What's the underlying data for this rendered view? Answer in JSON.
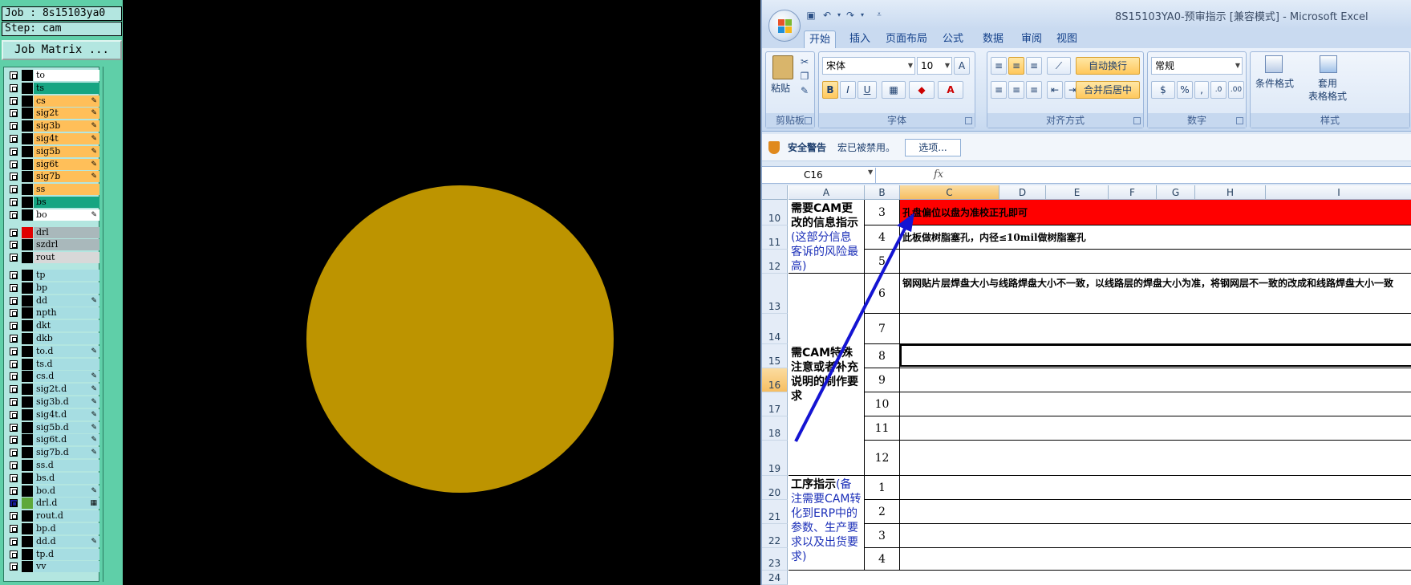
{
  "cam": {
    "job_line": "Job : 8s15103ya0",
    "step_line": "Step: cam",
    "job_matrix_label": "Job Matrix ...",
    "layers": [
      {
        "name": "to",
        "bg": "#ffffff",
        "swatch": "#000000",
        "mark": ""
      },
      {
        "name": "ts",
        "bg": "#16a582",
        "swatch": "#000000",
        "mark": ""
      },
      {
        "name": "cs",
        "bg": "#ffbf59",
        "swatch": "#000000",
        "mark": "✎"
      },
      {
        "name": "sig2t",
        "bg": "#ffbf59",
        "swatch": "#000000",
        "mark": "✎"
      },
      {
        "name": "sig3b",
        "bg": "#ffbf59",
        "swatch": "#000000",
        "mark": "✎"
      },
      {
        "name": "sig4t",
        "bg": "#ffbf59",
        "swatch": "#000000",
        "mark": "✎"
      },
      {
        "name": "sig5b",
        "bg": "#ffbf59",
        "swatch": "#000000",
        "mark": "✎"
      },
      {
        "name": "sig6t",
        "bg": "#ffbf59",
        "swatch": "#000000",
        "mark": "✎"
      },
      {
        "name": "sig7b",
        "bg": "#ffbf59",
        "swatch": "#000000",
        "mark": "✎"
      },
      {
        "name": "ss",
        "bg": "#ffbf59",
        "swatch": "#000000",
        "mark": ""
      },
      {
        "name": "bs",
        "bg": "#16a582",
        "swatch": "#000000",
        "mark": ""
      },
      {
        "name": "bo",
        "bg": "#ffffff",
        "swatch": "#000000",
        "mark": "✎"
      },
      {
        "name": "drl",
        "bg": "#a9b8bb",
        "swatch": "#e00000",
        "mark": ""
      },
      {
        "name": "szdrl",
        "bg": "#a9b8bb",
        "swatch": "#000000",
        "mark": ""
      },
      {
        "name": "rout",
        "bg": "#d8d8d8",
        "swatch": "#000000",
        "mark": ""
      },
      {
        "name": "tp",
        "bg": "#a6dde2",
        "swatch": "#000000",
        "mark": ""
      },
      {
        "name": "bp",
        "bg": "#a6dde2",
        "swatch": "#000000",
        "mark": ""
      },
      {
        "name": "dd",
        "bg": "#a6dde2",
        "swatch": "#000000",
        "mark": "✎"
      },
      {
        "name": "npth",
        "bg": "#a6dde2",
        "swatch": "#000000",
        "mark": ""
      },
      {
        "name": "dkt",
        "bg": "#a6dde2",
        "swatch": "#000000",
        "mark": ""
      },
      {
        "name": "dkb",
        "bg": "#a6dde2",
        "swatch": "#000000",
        "mark": ""
      },
      {
        "name": "to.d",
        "bg": "#a6dde2",
        "swatch": "#000000",
        "mark": "✎"
      },
      {
        "name": "ts.d",
        "bg": "#a6dde2",
        "swatch": "#000000",
        "mark": ""
      },
      {
        "name": "cs.d",
        "bg": "#a6dde2",
        "swatch": "#000000",
        "mark": "✎"
      },
      {
        "name": "sig2t.d",
        "bg": "#a6dde2",
        "swatch": "#000000",
        "mark": "✎"
      },
      {
        "name": "sig3b.d",
        "bg": "#a6dde2",
        "swatch": "#000000",
        "mark": "✎"
      },
      {
        "name": "sig4t.d",
        "bg": "#a6dde2",
        "swatch": "#000000",
        "mark": "✎"
      },
      {
        "name": "sig5b.d",
        "bg": "#a6dde2",
        "swatch": "#000000",
        "mark": "✎"
      },
      {
        "name": "sig6t.d",
        "bg": "#a6dde2",
        "swatch": "#000000",
        "mark": "✎"
      },
      {
        "name": "sig7b.d",
        "bg": "#a6dde2",
        "swatch": "#000000",
        "mark": "✎"
      },
      {
        "name": "ss.d",
        "bg": "#a6dde2",
        "swatch": "#000000",
        "mark": ""
      },
      {
        "name": "bs.d",
        "bg": "#a6dde2",
        "swatch": "#000000",
        "mark": ""
      },
      {
        "name": "bo.d",
        "bg": "#a6dde2",
        "swatch": "#000000",
        "mark": "✎"
      },
      {
        "name": "drl.d",
        "bg": "#a6dde2",
        "swatch": "#5ea83a",
        "mark": "▦"
      },
      {
        "name": "rout.d",
        "bg": "#a6dde2",
        "swatch": "#000000",
        "mark": ""
      },
      {
        "name": "bp.d",
        "bg": "#a6dde2",
        "swatch": "#000000",
        "mark": ""
      },
      {
        "name": "dd.d",
        "bg": "#a6dde2",
        "swatch": "#000000",
        "mark": "✎"
      },
      {
        "name": "tp.d",
        "bg": "#a6dde2",
        "swatch": "#000000",
        "mark": ""
      },
      {
        "name": "vv",
        "bg": "#a6dde2",
        "swatch": "#000000",
        "mark": ""
      }
    ],
    "pad_color": "#bd9400"
  },
  "excel": {
    "title": "8S15103YA0-预审指示  [兼容模式]  -  Microsoft Excel",
    "tabs": [
      "开始",
      "插入",
      "页面布局",
      "公式",
      "数据",
      "审阅",
      "视图"
    ],
    "active_tab": "开始",
    "ribbon": {
      "clipboard": {
        "paste": "粘贴",
        "group": "剪贴板"
      },
      "font": {
        "name": "宋体",
        "size": "10",
        "group": "字体",
        "bold": "B",
        "italic": "I",
        "underline": "U",
        "grow": "A",
        "shrink": "A"
      },
      "alignment": {
        "wrap": "自动换行",
        "merge": "合并后居中",
        "group": "对齐方式"
      },
      "number": {
        "format": "常规",
        "percent": "%",
        "comma": ",",
        "group": "数字"
      },
      "styles": {
        "conditional": "条件格式",
        "table_line1": "套用",
        "table_line2": "表格格式",
        "group": "样式"
      }
    },
    "security": {
      "title": "安全警告",
      "message": "宏已被禁用。",
      "options": "选项..."
    },
    "name_box": "C16",
    "fx": "fx",
    "columns": [
      "A",
      "B",
      "C",
      "D",
      "E",
      "F",
      "G",
      "H",
      "I"
    ],
    "selected_column": "C",
    "rows": [
      "10",
      "11",
      "12",
      "13",
      "14",
      "15",
      "16",
      "17",
      "18",
      "19",
      "20",
      "21",
      "22",
      "23",
      "24"
    ],
    "selected_row": "16",
    "section_a1": {
      "bold": "需要CAM更改的信息指示",
      "note": "(这部分信息客诉的风险最高)"
    },
    "section_a2": {
      "bold": "需CAM特殊注意或者补充说明的制作要求"
    },
    "section_a3": {
      "bold": "工序指示",
      "note": "(备注需要CAM转化到ERP中的参数、生产要求以及出货要求)"
    },
    "b_values": [
      "3",
      "4",
      "5",
      "6",
      "7",
      "8",
      "9",
      "10",
      "11",
      "12",
      "1",
      "2",
      "3",
      "4"
    ],
    "c_texts": {
      "r3": "孔盘偏位以盘为准校正孔即可",
      "r4": "此板做树脂塞孔，内径≤10mil做树脂塞孔",
      "r6": "钢网贴片层焊盘大小与线路焊盘大小不一致，以线路层的焊盘大小为准，将钢网层不一致的改成和线路焊盘大小一致"
    },
    "highlight_color": "#ff0000",
    "arrow_color": "#1414d2"
  }
}
